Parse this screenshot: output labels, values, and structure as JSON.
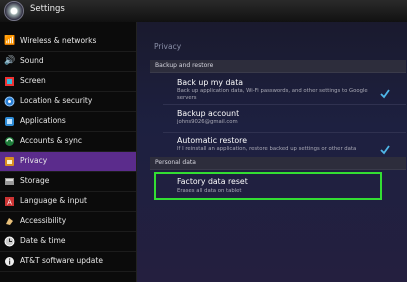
{
  "header": {
    "title": "Settings"
  },
  "sidebar": {
    "items": [
      {
        "label": "Wireless & networks"
      },
      {
        "label": "Sound"
      },
      {
        "label": "Screen"
      },
      {
        "label": "Location & security"
      },
      {
        "label": "Applications"
      },
      {
        "label": "Accounts & sync"
      },
      {
        "label": "Privacy"
      },
      {
        "label": "Storage"
      },
      {
        "label": "Language & input"
      },
      {
        "label": "Accessibility"
      },
      {
        "label": "Date & time"
      },
      {
        "label": "AT&T software update"
      }
    ],
    "active_index": 6
  },
  "main": {
    "title": "Privacy",
    "backup_section": {
      "header": "Backup and restore",
      "backup_data": {
        "title": "Back up my data",
        "summary": "Back up application data, Wi-Fi passwords, and other settings to Google servers",
        "checked": true
      },
      "backup_account": {
        "title": "Backup account",
        "summary": "johns9026@gmail.com"
      },
      "auto_restore": {
        "title": "Automatic restore",
        "summary": "If I reinstall an application, restore backed up settings or other data",
        "checked": true
      }
    },
    "personal_section": {
      "header": "Personal data",
      "factory_reset": {
        "title": "Factory data reset",
        "summary": "Erases all data on tablet"
      }
    }
  },
  "colors": {
    "active_item": "#5b2c8c",
    "highlight_box": "#33dd33",
    "checkmark": "#4fb7e8"
  }
}
